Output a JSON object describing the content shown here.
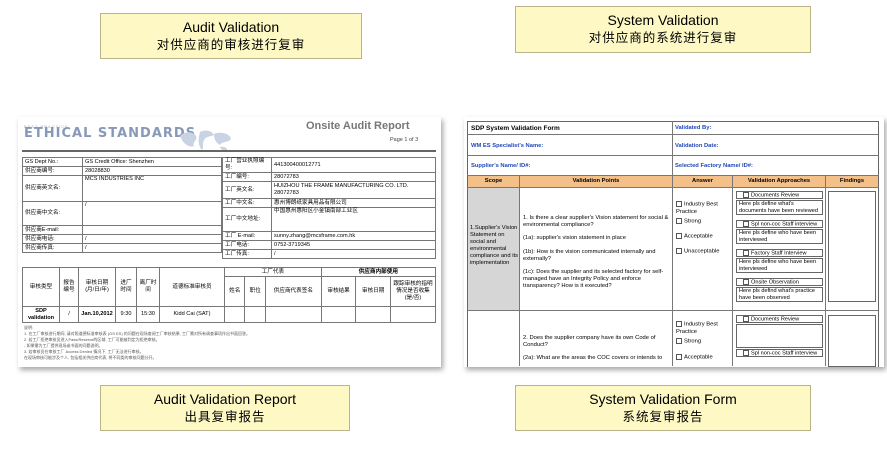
{
  "captions": {
    "audit_validation": {
      "en": "Audit Validation",
      "cn": "对供应商的审核进行复审"
    },
    "system_validation": {
      "en": "System Validation",
      "cn": "对供应商的系统进行复审"
    },
    "audit_report": {
      "en": "Audit Validation Report",
      "cn": "出具复审报告"
    },
    "system_form": {
      "en": "System Validation Form",
      "cn": "系统复审报告"
    }
  },
  "audit_report_doc": {
    "logo_small": "BEST PRACTICE",
    "logo": "ETHICAL STANDARDS",
    "title": "Onsite Audit Report",
    "page": "Page 1 of 3",
    "left_rows": [
      {
        "label": "GS Dept No.:",
        "value": "GS Credit Office:   Shenzhen"
      },
      {
        "label": "供应商编号:",
        "value": "28028830"
      },
      {
        "label": "供应商英文名:",
        "value": "MCS INDUSTRIES INC"
      },
      {
        "label": "",
        "value": ""
      },
      {
        "label": "供应商中文名:",
        "value": "/"
      },
      {
        "label": "供应商E-mail:",
        "value": ""
      },
      {
        "label": "供应商电话:",
        "value": "/"
      },
      {
        "label": "供应商传真:",
        "value": "/"
      }
    ],
    "right_rows": [
      {
        "label": "工厂营业执照编号:",
        "value": "441300400012771"
      },
      {
        "label": "工厂编号:",
        "value": "28072783"
      },
      {
        "label": "工厂英文名:",
        "value": "HUIZHOU THE FRAME MANUFACTURING CO. LTD. 28072783"
      },
      {
        "label": "工厂中文名:",
        "value": "惠州博朗纸家具用品有限公司"
      },
      {
        "label": "工厂中文地址:",
        "value": "中国惠州惠阳区小金镇南部工业区"
      },
      {
        "label": "工厂 E-mail:",
        "value": "sunny.zhang@mcsframe.com.hk"
      },
      {
        "label": "工厂电话:",
        "value": "0752-3719345"
      },
      {
        "label": "工厂传真:",
        "value": "/"
      }
    ],
    "audit_headers": [
      "审核类型",
      "报告编号",
      "审核日期 (月/日/年)",
      "进厂时间",
      "离厂时间",
      "道德标准审核员"
    ],
    "factory_rep_header": "工厂代表",
    "factory_rep_cols": [
      "姓名",
      "职位",
      "供应商代表签名"
    ],
    "internal_header": "供应商内部使用",
    "internal_cols": [
      "审核结果",
      "审核日期",
      "跟踪审核的指明情况是否收集 (是/否)"
    ],
    "audit_row": [
      "SDP validation",
      "/",
      "Jan.10,2012",
      "9:30",
      "15:30",
      "Kidd Cai (SAT)"
    ],
    "notes": [
      "说明:",
      "1. 在工厂审核进行期间, 请对照道德标准审核表 (GS ES) 的问题在现场查阅工厂审核结果, 工厂需对所有调查事项作出书面回答。",
      "2. 若工厂拒绝审核员进入Pass/Reserve的区域, 工厂可能被判定为拒绝审核。",
      "   - 如果需为工厂提供现场或书面的问题说明。",
      "3. 若审核员在审核工厂 Access Denied 情况下, 工厂无法进行审核。",
      "   在现场审核可能涉及个人, 包括相关供应商代表, 将不同类的审核问题分开。"
    ]
  },
  "system_form_doc": {
    "title": "SDP System Validation Form",
    "validated_by": "Validated By:",
    "specialist": "WM ES Specialist's Name:",
    "validation_date": "Validation Date:",
    "supplier": "Supplier's Name/ ID#:",
    "factory": "Selected Factory Name/ ID#:",
    "headers": [
      "Scope",
      "Validation Points",
      "Answer",
      "Validation Approaches",
      "Findings"
    ],
    "scope": "1.Supplier's Vision Statement on social and environmental compliance and its implementation",
    "points": [
      "1. Is there a clear supplier's Vision statement for social & environmental compliance?",
      "(1a): supplier's vision statement in place",
      "(1b): How is the vision communicated internally and externally?",
      "(1c): Does the supplier and its selected factory for self-managed have an Integrity Policy and enforce transparency? How is it executed?"
    ],
    "answers": [
      "Industry Best Practice",
      "Strong",
      "Acceptable",
      "Unacceptable"
    ],
    "approaches": [
      "Documents Review",
      "Here pls define what's documents have been reviewed",
      "Spl non-coc Staff interview",
      "Here pls define who have been interviewed",
      "Factory Staff Interview",
      "Here pls define who have been interviewed",
      "Onsite Observation",
      "Here pls defind what's practice have been observed"
    ],
    "points2": [
      "2. Does the supplier company have its own Code of Conduct?",
      "(2a): What are the areas the COC covers or intends to"
    ],
    "answers2": [
      "Industry Best Practice",
      "Strong",
      "Acceptable"
    ],
    "approaches2": [
      "Documents Review",
      "Spl non-coc Staff interview"
    ]
  },
  "colors": {
    "caption_bg": "#fdf8c4",
    "header_orange": "#f4c08a",
    "label_blue": "#2147b8"
  }
}
